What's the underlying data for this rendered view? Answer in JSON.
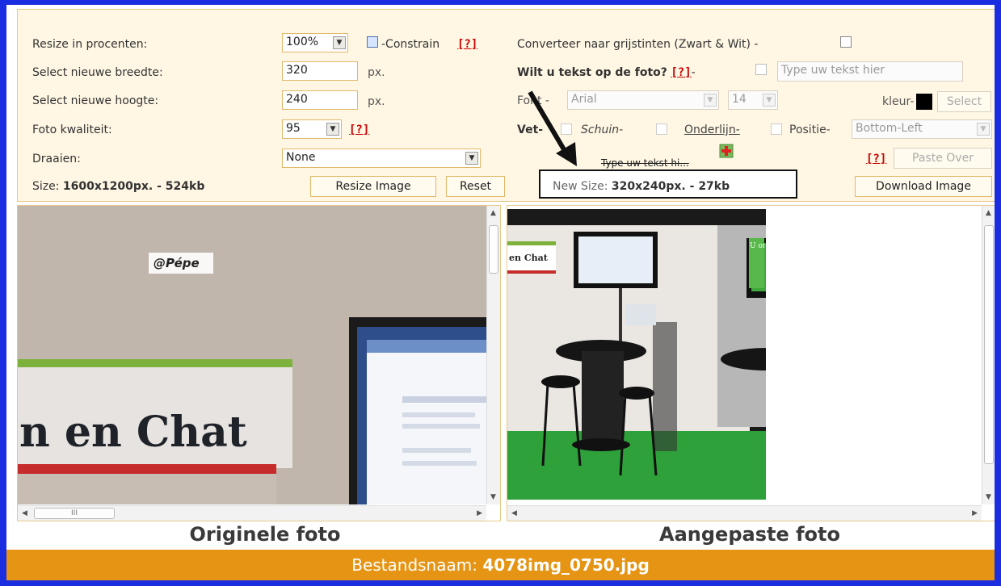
{
  "left_labels": {
    "resize": "Resize in procenten:",
    "width": "Select nieuwe breedte:",
    "height": "Select nieuwe hoogte:",
    "quality": "Foto kwaliteit:",
    "rotate": "Draaien:",
    "size_prefix": "Size: ",
    "size_value": "1600x1200px. - 524kb"
  },
  "controls": {
    "resize_percent": "100%",
    "constrain_label": "-Constrain",
    "help": "[?]",
    "width_value": "320",
    "height_value": "240",
    "px": "px.",
    "quality_value": "95",
    "rotate_value": "None",
    "resize_button": "Resize Image",
    "reset_button": "Reset"
  },
  "right_controls": {
    "grayscale_label": "Converteer naar grijstinten (Zwart & Wit) -",
    "text_question": "Wilt u tekst op de foto?",
    "dash": "-",
    "text_placeholder": "Type uw tekst hier",
    "font_label": "Font -",
    "font_value": "Arial",
    "font_size": "14",
    "color_label": "kleur-",
    "color_value": "#000000",
    "select_button": "Select",
    "bold_label": "Vet-",
    "italic_label": "Schuin-",
    "underline_label": "Onderlijn-",
    "position_label": "Positie-",
    "position_value": "Bottom-Left",
    "preview_text": "Type uw tekst hi...",
    "paste_button": "Paste Over",
    "new_size_prefix": "New Size: ",
    "new_size_value": "320x240px. - 27kb",
    "download_button": "Download Image"
  },
  "images": {
    "original_caption": "Originele foto",
    "adjusted_caption": "Aangepaste foto",
    "watermark": "@Pépe",
    "sign_text": "n en Chat",
    "sign_text_small": "en Chat",
    "screen_text": "U ontdekt er alles over, hier in de groep BLOGGEN\"",
    "scroll_mark": "III"
  },
  "footer": {
    "prefix": "Bestandsnaam: ",
    "filename": "4078img_0750.jpg"
  }
}
